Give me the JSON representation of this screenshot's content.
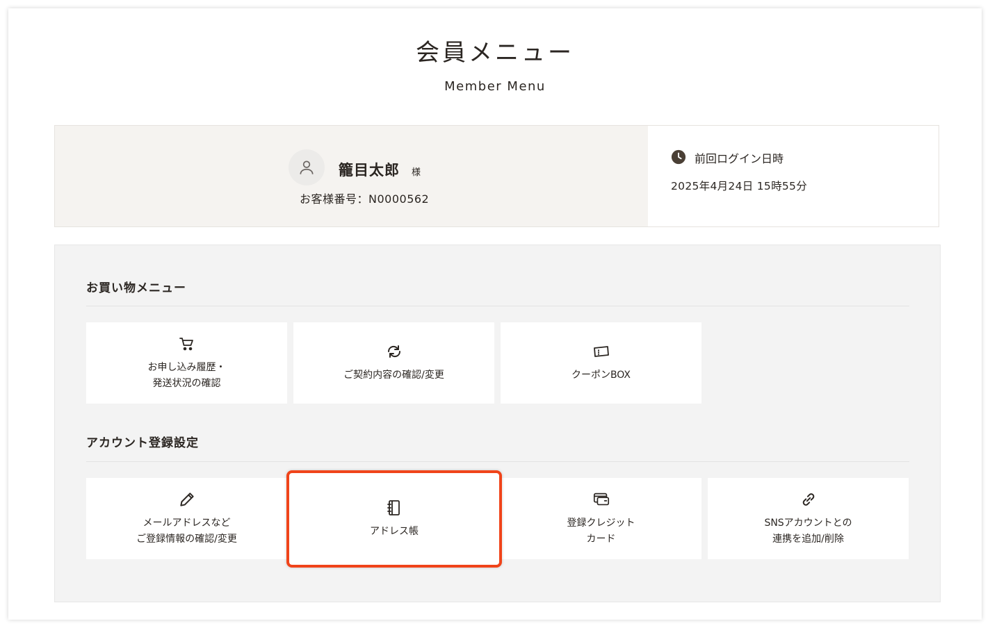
{
  "header": {
    "title": "会員メニュー",
    "subtitle": "Member Menu"
  },
  "user": {
    "name": "籠目太郎",
    "suffix": "様",
    "customer_number": "お客様番号：N0000562",
    "avatar_icon": "user-icon"
  },
  "last_login": {
    "label": "前回ログイン日時",
    "value": "2025年4月24日 15時55分",
    "icon": "clock-icon"
  },
  "shopping_menu": {
    "heading": "お買い物メニュー",
    "items": [
      {
        "label": "お申し込み履歴・\n発送状況の確認",
        "icon": "cart-icon"
      },
      {
        "label": "ご契約内容の確認/変更",
        "icon": "refresh-icon"
      },
      {
        "label": "クーポンBOX",
        "icon": "ticket-icon"
      }
    ]
  },
  "account_settings": {
    "heading": "アカウント登録設定",
    "items": [
      {
        "label": "メールアドレスなど\nご登録情報の確認/変更",
        "icon": "pencil-icon"
      },
      {
        "label": "アドレス帳",
        "icon": "address-book-icon"
      },
      {
        "label": "登録クレジット\nカード",
        "icon": "credit-card-icon"
      },
      {
        "label": "SNSアカウントとの\n連携を追加/削除",
        "icon": "link-icon"
      }
    ]
  },
  "colors": {
    "accent": "#f0441a",
    "text": "#2b2622",
    "user_panel_bg": "#f5f3f0",
    "menu_bg": "#f3f3f3"
  }
}
